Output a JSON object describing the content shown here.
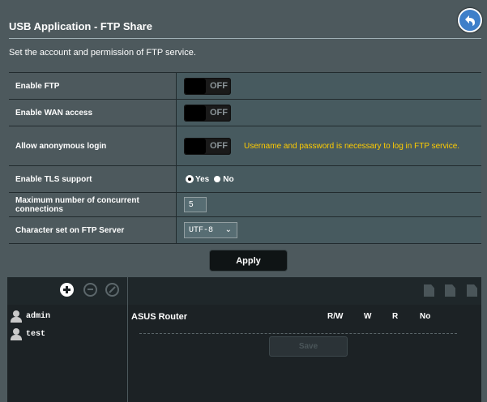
{
  "header": {
    "title": "USB Application - FTP Share",
    "subtitle": "Set the account and permission of FTP service."
  },
  "settings": {
    "enable_ftp": {
      "label": "Enable FTP",
      "state": "OFF"
    },
    "enable_wan": {
      "label": "Enable WAN access",
      "state": "OFF"
    },
    "anonymous": {
      "label": "Allow anonymous login",
      "state": "OFF",
      "note": "Username and password is necessary to log in FTP service."
    },
    "tls": {
      "label": "Enable TLS support",
      "yes": "Yes",
      "no": "No",
      "selected": "Yes"
    },
    "max_conn": {
      "label": "Maximum number of concurrent connections",
      "value": "5"
    },
    "charset": {
      "label": "Character set on FTP Server",
      "value": "UTF-8"
    }
  },
  "apply_label": "Apply",
  "accounts": [
    "admin",
    "test"
  ],
  "permissions": {
    "device": "ASUS Router",
    "cols": [
      "R/W",
      "W",
      "R",
      "No"
    ]
  },
  "save_label": "Save",
  "colors": {
    "warning": "#ffcc00",
    "back_button": "#3e7fc9"
  }
}
